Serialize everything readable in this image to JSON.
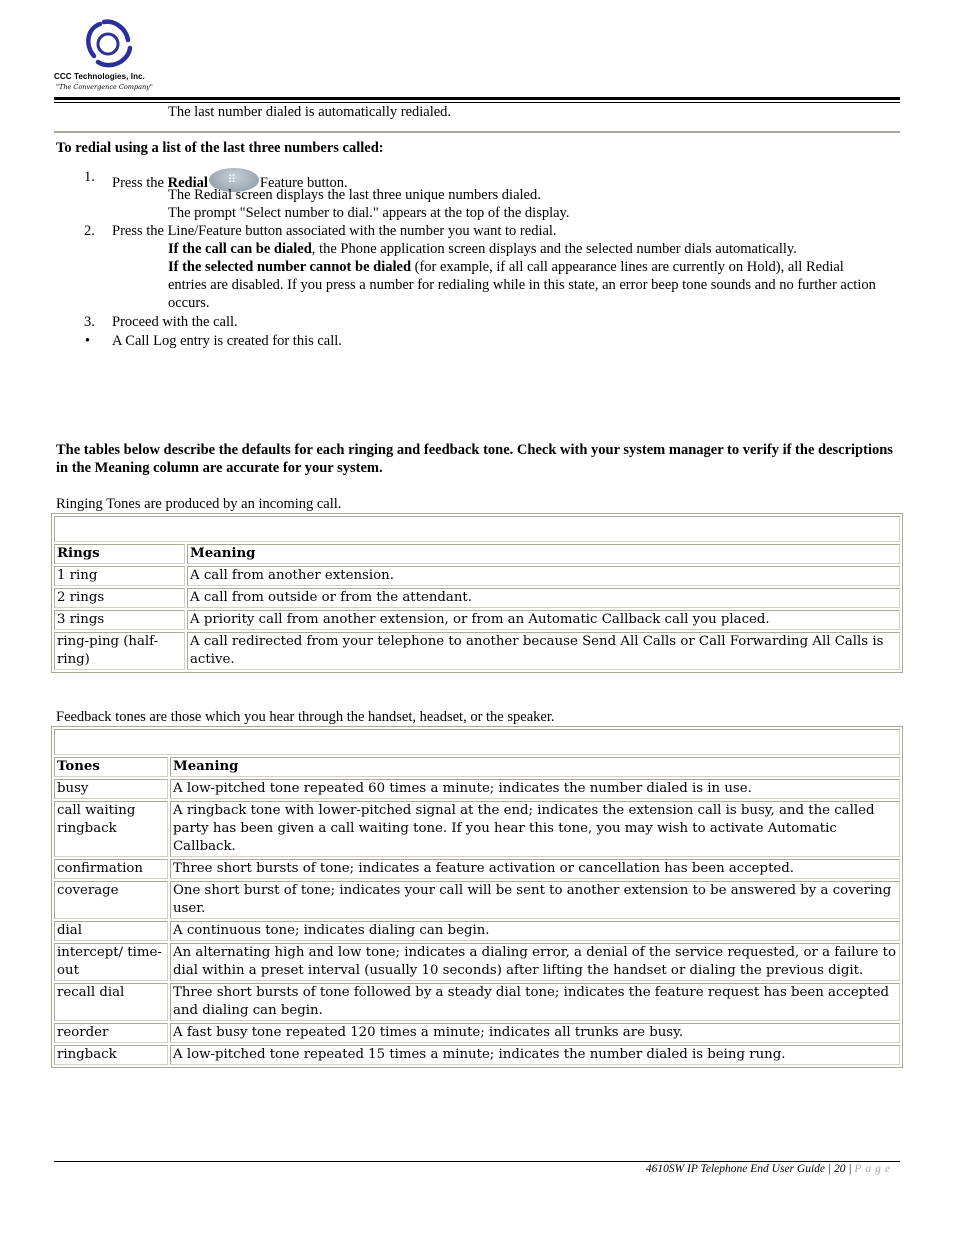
{
  "header": {
    "company_name": "CCC Technologies, Inc.",
    "tagline": "\"The Convergence Company\"",
    "brand_color": "#2a2f9a"
  },
  "intro_line": "The last number dialed is automatically redialed.",
  "redial_section": {
    "heading": "To redial using a list of the last three numbers called:",
    "step1": {
      "number": "1.",
      "prefix": "Press the ",
      "bold": "Redial",
      "suffix": "Feature button.",
      "icon": "redial-button-icon",
      "sub_lines": [
        "The Redial screen displays the last three unique numbers dialed.",
        "The prompt \"Select number to dial.\" appears at the top of the display."
      ]
    },
    "step2": {
      "number": "2.",
      "text": "Press the Line/Feature button associated with the number you want to redial.",
      "sub1_bold": "If the call can be dialed",
      "sub1_rest": ", the Phone application screen displays and the selected number dials automatically.",
      "sub2_bold": "If the selected number cannot be dialed",
      "sub2_rest": " (for example, if all call appearance lines are currently on Hold), all Redial entries are disabled. If you press a number for redialing while in this state, an error beep tone sounds and no further action occurs."
    },
    "step3": {
      "number": "3.",
      "text": "Proceed with the call."
    },
    "bullet": {
      "symbol": "•",
      "text": "A Call Log entry is created for this call."
    }
  },
  "tones_intro": "The tables below describe the defaults for each ringing and feedback tone. Check with your system manager to verify if the descriptions in the Meaning column are accurate for your system.",
  "ringing": {
    "intro": "Ringing Tones are produced by an incoming call.",
    "headers": [
      "Rings",
      "Meaning"
    ],
    "rows": [
      [
        "1 ring",
        "A call from another extension."
      ],
      [
        "2 rings",
        "A call from outside or from the attendant."
      ],
      [
        "3 rings",
        "A priority call from another extension, or from an Automatic Callback call you placed."
      ],
      [
        "ring-ping (half-ring)",
        "A call redirected from your telephone to another because Send All Calls or Call Forwarding All Calls is active."
      ]
    ]
  },
  "feedback": {
    "intro": "Feedback tones are those which you hear through the handset, headset, or the speaker.",
    "headers": [
      "Tones",
      "Meaning"
    ],
    "rows": [
      [
        "busy",
        "A low-pitched tone repeated 60 times a minute; indicates the number dialed is in use."
      ],
      [
        "call waiting ringback",
        "A ringback tone with lower-pitched signal at the end; indicates the extension call is busy, and the called party has been given a call waiting tone. If you hear this tone, you may wish to activate Automatic Callback."
      ],
      [
        "confirmation",
        "Three short bursts of tone; indicates a feature activation or cancellation has been accepted."
      ],
      [
        "coverage",
        "One short burst of tone; indicates your call will be sent to another extension to be answered by a covering user."
      ],
      [
        "dial",
        "A continuous tone; indicates dialing can begin."
      ],
      [
        "intercept/ time-out",
        "An alternating high and low tone; indicates a dialing error, a denial of the service requested, or a failure to dial within a preset interval (usually 10 seconds) after lifting the handset or dialing the previous digit."
      ],
      [
        "recall dial",
        "Three short bursts of tone followed by a steady dial tone; indicates the feature request has been accepted and dialing can begin."
      ],
      [
        "reorder",
        "A fast busy tone repeated 120 times a minute; indicates all trunks are busy."
      ],
      [
        "ringback",
        "A low-pitched tone repeated 15 times a minute; indicates the number dialed is being rung."
      ]
    ]
  },
  "footer": {
    "title": "4610SW IP Telephone End User Guide",
    "separator": "|",
    "page_number": "20",
    "page_word": "Page"
  }
}
